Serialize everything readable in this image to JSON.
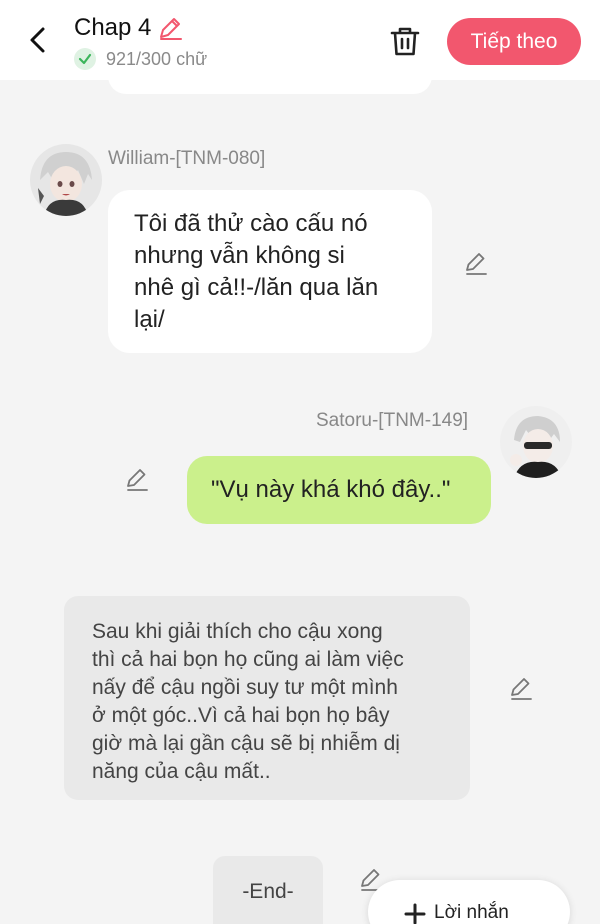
{
  "header": {
    "title": "Chap 4",
    "word_count": "921/300 chữ",
    "next_label": "Tiếp theo"
  },
  "messages": [
    {
      "sender": "William-[TNM-080]",
      "text_lines": [
        "Tôi đã thử cào cấu nó",
        "nhưng vẫn không si",
        "nhê gì cả!!-/lăn qua lăn",
        "lại/"
      ]
    },
    {
      "sender": "Satoru-[TNM-149]",
      "text_lines": [
        "\"Vụ này khá khó đây..\""
      ]
    }
  ],
  "narration": {
    "text_lines": [
      "Sau khi giải thích cho cậu xong",
      "thì cả hai bọn họ cũng ai làm việc",
      "nấy để cậu ngồi suy tư một mình",
      "ở một góc..Vì cả hai bọn họ bây",
      "giờ mà lại gần cậu sẽ bị nhiễm dị",
      "năng của cậu mất.."
    ]
  },
  "end_block": {
    "text": "-End-"
  },
  "fab": {
    "label": "Lời nhắn"
  },
  "colors": {
    "accent": "#f2576e",
    "bubble_green": "#cbf08c",
    "check_green": "#3cb55b"
  }
}
